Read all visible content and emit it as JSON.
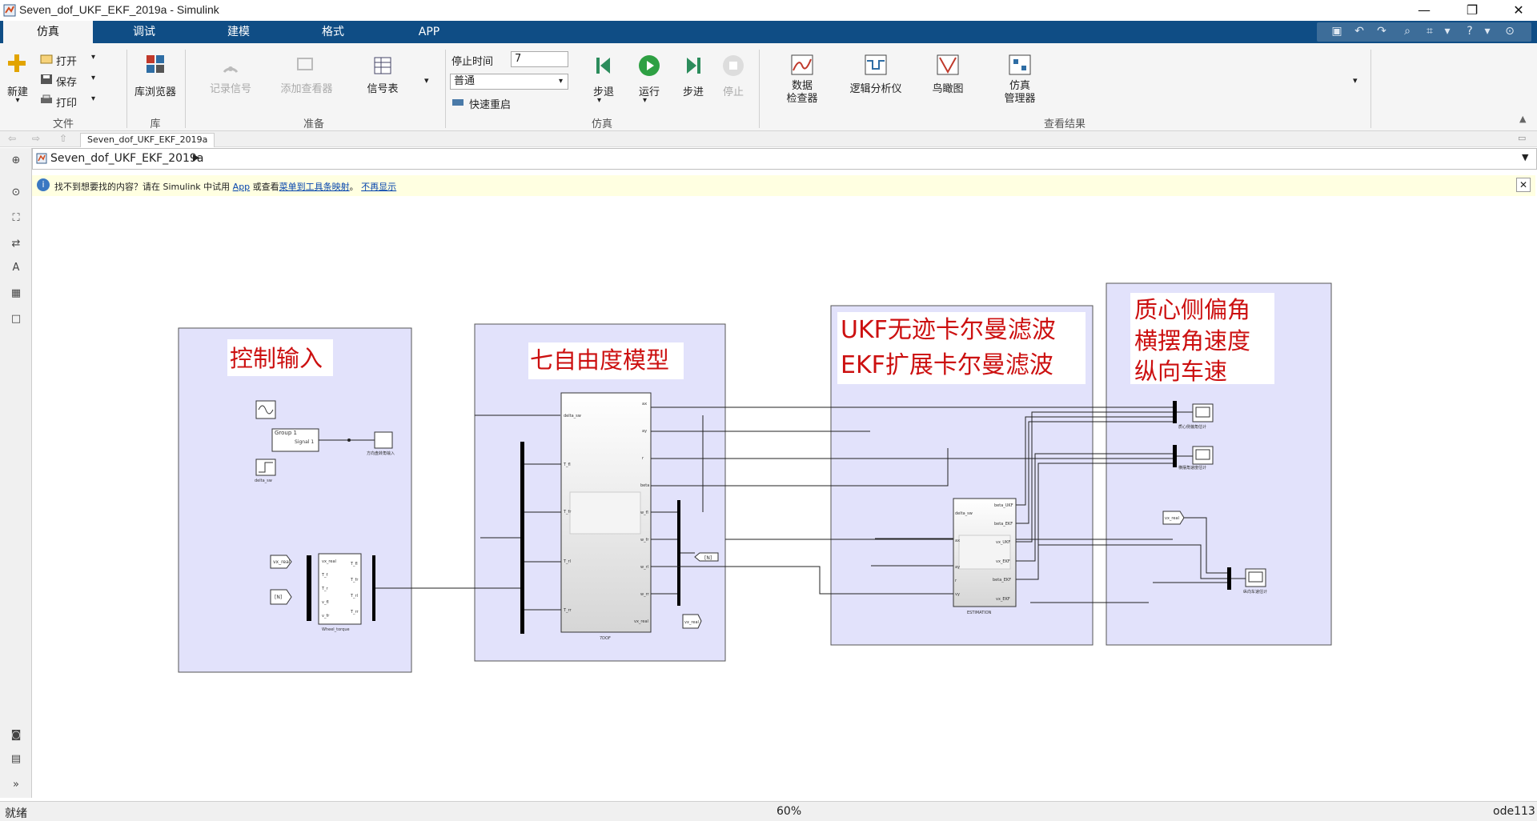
{
  "window": {
    "title": "Seven_dof_UKF_EKF_2019a - Simulink"
  },
  "tabs": [
    "仿真",
    "调试",
    "建模",
    "格式",
    "APP"
  ],
  "ribbon": {
    "file": {
      "new": "新建",
      "open": "打开",
      "save": "保存",
      "print": "打印",
      "group": "文件"
    },
    "library": {
      "browser": "库浏览器",
      "group": "库"
    },
    "prepare": {
      "log_signals": "记录信号",
      "add_viewer": "添加查看器",
      "signal_table": "信号表",
      "group": "准备"
    },
    "simulate": {
      "stop_time_label": "停止时间",
      "stop_time_value": "7",
      "mode": "普通",
      "fast_restart": "快速重启",
      "step_back": "步退",
      "run": "运行",
      "step_forward": "步进",
      "stop": "停止",
      "group": "仿真"
    },
    "review": {
      "data_inspector": "数据\n检查器",
      "logic_analyzer": "逻辑分析仪",
      "birds_eye": "鸟瞰图",
      "sim_manager": "仿真\n管理器",
      "group": "查看结果"
    }
  },
  "nav": {
    "breadcrumb_tab": "Seven_dof_UKF_EKF_2019a"
  },
  "address": {
    "path": "Seven_dof_UKF_EKF_2019a"
  },
  "infobar": {
    "text1": "找不到想要找的内容？请在 Simulink 中试用 ",
    "link_app": "App",
    "text2": " 或查看",
    "link_menu": "菜单到工具条映射",
    "text3": "。",
    "link_dont_show": "不再显示"
  },
  "model": {
    "area1_title": "控制输入",
    "area2_title": "七自由度模型",
    "area3_title_line1": "UKF无迹卡尔曼滤波",
    "area3_title_line2": "EKF扩展卡尔曼滤波",
    "area4_title_line1": "质心侧偏角",
    "area4_title_line2": "横摆角速度",
    "area4_title_line3": "纵向车速",
    "labels": {
      "group1": "Group 1",
      "signal1": "Signal 1",
      "scope_ctrl": "方向盘转角输入",
      "step_label": "delta_sw",
      "goto_vx": "vx_real",
      "from_in": "[N]",
      "ctrl_block": "Wheel_torque",
      "dof_block": "7DOF",
      "est_block": "ESTIMATION",
      "goto_n": "[N]",
      "goto_vx2": "vx_real",
      "from_vx3": "vx_real",
      "scope1": "质心侧偏角估计",
      "scope2": "横摆角速度估计",
      "scope3": "纵向车速估计"
    },
    "ports": {
      "ctrl_in": [
        "vx_real",
        "T_f",
        "T_r",
        "v_fl",
        "v_fr"
      ],
      "ctrl_out": [
        "T_fl",
        "T_fr",
        "T_rl",
        "T_rr"
      ],
      "dof_in": [
        "delta_sw",
        "T_fl",
        "T_fr",
        "T_rl",
        "T_rr"
      ],
      "dof_out": [
        "ax",
        "ay",
        "r",
        "beta",
        "w_fl",
        "w_fr",
        "w_rl",
        "w_rr",
        "vx_real"
      ],
      "est_in": [
        "delta_sw",
        "ax",
        "ay",
        "r",
        "vy"
      ],
      "est_out": [
        "beta_UKF",
        "beta_EKF",
        "vx_UKF",
        "vx_EKF",
        "beta_EKF",
        "vx_EKF"
      ]
    }
  },
  "status": {
    "left": "就绪",
    "zoom": "60%",
    "solver": "ode113"
  }
}
